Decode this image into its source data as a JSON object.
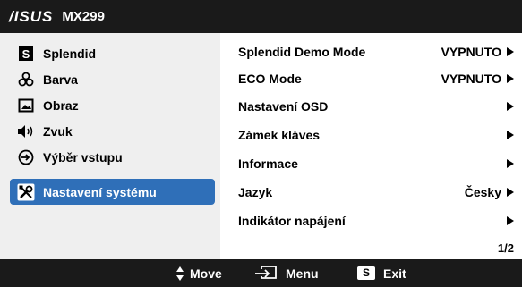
{
  "title": {
    "brand": "/ISUS",
    "model": "MX299"
  },
  "sidebar": {
    "items": [
      {
        "label": "Splendid",
        "icon": "splendid-s-icon"
      },
      {
        "label": "Barva",
        "icon": "color-icon"
      },
      {
        "label": "Obraz",
        "icon": "image-icon"
      },
      {
        "label": "Zvuk",
        "icon": "speaker-icon"
      },
      {
        "label": "Výběr vstupu",
        "icon": "input-select-icon"
      },
      {
        "label": "Nastavení systému",
        "icon": "tools-icon",
        "selected": true
      }
    ]
  },
  "main": {
    "rows": [
      {
        "label": "Splendid Demo Mode",
        "value": "VYPNUTO"
      },
      {
        "label": "ECO Mode",
        "value": "VYPNUTO"
      },
      {
        "label": "Nastavení OSD",
        "value": ""
      },
      {
        "label": "Zámek kláves",
        "value": ""
      },
      {
        "label": "Informace",
        "value": ""
      },
      {
        "label": "Jazyk",
        "value": "Česky"
      },
      {
        "label": "Indikátor napájení",
        "value": ""
      }
    ],
    "page": "1/2"
  },
  "footer": {
    "move_label": "Move",
    "menu_label": "Menu",
    "exit_key": "S",
    "exit_label": "Exit"
  },
  "colors": {
    "bar": "#1a1a1a",
    "selected": "#2f6fb8",
    "sidebar_bg": "#efefef"
  }
}
